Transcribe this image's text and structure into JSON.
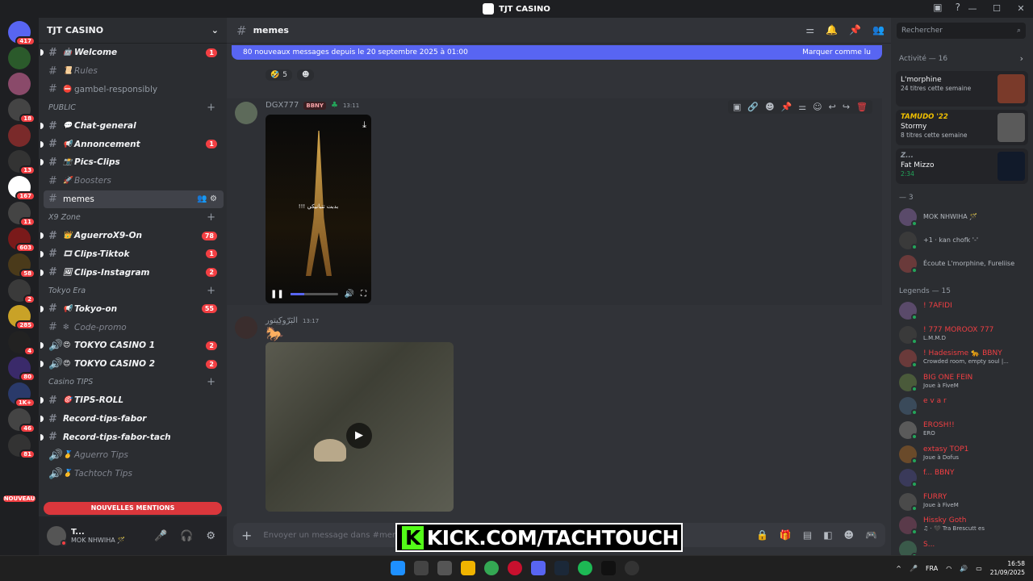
{
  "window": {
    "title": "TJT CASINO",
    "controls": [
      "—",
      "☐",
      "✕"
    ]
  },
  "rail": {
    "home_badge": "417",
    "badges": [
      "",
      "",
      "18",
      "",
      "13",
      "167",
      "11",
      "603",
      "58",
      "2",
      "285",
      "4",
      "80",
      "1K+",
      "46",
      "81"
    ],
    "new_label": "NOUVEAU"
  },
  "guild": {
    "name": "TJT CASINO"
  },
  "channels": [
    {
      "kind": "ch",
      "emoji": "🤖",
      "name": "Welcome",
      "style": "bold",
      "count": "1"
    },
    {
      "kind": "ch",
      "emoji": "📜",
      "name": "Rules",
      "style": "dim"
    },
    {
      "kind": "ch",
      "emoji": "⛔",
      "name": "gambel-responsibly",
      "style": "normal"
    },
    {
      "kind": "cat",
      "name": "PUBLIC"
    },
    {
      "kind": "ch",
      "emoji": "💬",
      "name": "Chat-general",
      "style": "bold"
    },
    {
      "kind": "ch",
      "emoji": "📢",
      "name": "Annoncement",
      "style": "bold",
      "count": "1"
    },
    {
      "kind": "ch",
      "emoji": "📸",
      "name": "Pics-Clips",
      "style": "bold"
    },
    {
      "kind": "ch",
      "emoji": "🚀",
      "name": "Boosters",
      "style": "dim"
    },
    {
      "kind": "ch",
      "emoji": "",
      "name": "memes",
      "style": "sel"
    },
    {
      "kind": "cat",
      "name": "X9 Zone"
    },
    {
      "kind": "ch",
      "emoji": "👑",
      "name": "AguerroX9-On",
      "style": "bold",
      "count": "78"
    },
    {
      "kind": "ch",
      "emoji": "🎞",
      "name": "Clips-Tiktok",
      "style": "bold",
      "count": "1"
    },
    {
      "kind": "ch",
      "emoji": "🖼",
      "name": "Clips-Instagram",
      "style": "bold",
      "count": "2"
    },
    {
      "kind": "cat",
      "name": "Tokyo Era"
    },
    {
      "kind": "ch",
      "emoji": "📢",
      "name": "Tokyo-on",
      "style": "bold",
      "count": "55"
    },
    {
      "kind": "ch",
      "emoji": "❇",
      "name": "Code-promo",
      "style": "dim"
    },
    {
      "kind": "ch",
      "emoji": "😍",
      "name": "TOKYO CASINO 1",
      "style": "voice",
      "count": "2"
    },
    {
      "kind": "ch",
      "emoji": "😍",
      "name": "TOKYO CASINO 2",
      "style": "voice",
      "count": "2"
    },
    {
      "kind": "cat",
      "name": "Casino TIPS"
    },
    {
      "kind": "ch",
      "emoji": "🎯",
      "name": "TIPS-ROLL",
      "style": "bold"
    },
    {
      "kind": "ch",
      "emoji": "",
      "name": "Record-tips-fabor",
      "style": "bold"
    },
    {
      "kind": "ch",
      "emoji": "",
      "name": "Record-tips-fabor-tach",
      "style": "bold"
    },
    {
      "kind": "ch",
      "emoji": "🥇",
      "name": "Aguerro Tips",
      "style": "voicedim"
    },
    {
      "kind": "ch",
      "emoji": "🥇",
      "name": "Tachtoch Tips",
      "style": "voicedim"
    }
  ],
  "mentions_label": "NOUVELLES MENTIONS",
  "user": {
    "name": "T...",
    "status": "MOK NHWIHA 🪄"
  },
  "channel_header": {
    "name": "memes"
  },
  "new_messages": {
    "text": "80 nouveaux messages depuis le 20 septembre 2025 à 01:00",
    "action": "Marquer comme lu"
  },
  "reactions": [
    {
      "emoji": "🤣",
      "count": "5"
    },
    {
      "emoji": "☻",
      "count": ""
    }
  ],
  "messages": [
    {
      "author": "DGX777",
      "tag": "BBNY",
      "time": "13:11",
      "video_text": "!!! بدبت تتبانيكي"
    },
    {
      "author": "البَرّوكِيتور",
      "time": "13:17",
      "emoji": "🐎"
    }
  ],
  "composer": {
    "placeholder": "Envoyer un message dans #memes"
  },
  "overlay": {
    "text": "KICK.COM/TACHTOUCH"
  },
  "right": {
    "search_placeholder": "Rechercher",
    "activity_header": "Activité — 16",
    "cards": [
      {
        "who": "",
        "title": "L'morphine",
        "status": "24 titres cette semaine"
      },
      {
        "who": "TAMUDO '22",
        "title": "Stormy",
        "status": "8 titres cette semaine"
      },
      {
        "who": "Z...",
        "title": "Fat Mizzo",
        "status": "2:34"
      }
    ],
    "section1": "— 3",
    "members1": [
      {
        "name": "MOK NHWIHA 🪄",
        "status": ""
      },
      {
        "name": "+1 · kan chofk '-'",
        "status": ""
      },
      {
        "name": "Écoute L'morphine, Fureliise",
        "status": ""
      }
    ],
    "section2": "Legends — 15",
    "members2": [
      {
        "name": "! 7AFIDI",
        "status": ""
      },
      {
        "name": "! 777 MOROOX 777",
        "status": "L.M.M.D"
      },
      {
        "name": "! Hadesisme 🐆 BBNY",
        "status": "Crowded room, empty soul |..."
      },
      {
        "name": "BIG ONE FEIN",
        "status": "Joue à FiveM"
      },
      {
        "name": "e v a r",
        "status": ""
      },
      {
        "name": "EROSH!!",
        "status": "ERO"
      },
      {
        "name": "extasy TOP1",
        "status": "Joue à Dofus"
      },
      {
        "name": "f... BBNY",
        "status": ""
      },
      {
        "name": "FURRY",
        "status": "Joue à FiveM"
      },
      {
        "name": "Hissky Goth",
        "status": "♫ · 🖤 Tra Brescutt es"
      },
      {
        "name": "S...",
        "status": ""
      }
    ]
  },
  "taskbar": {
    "lang": "FRA",
    "time": "16:58",
    "date": "21/09/2025"
  }
}
